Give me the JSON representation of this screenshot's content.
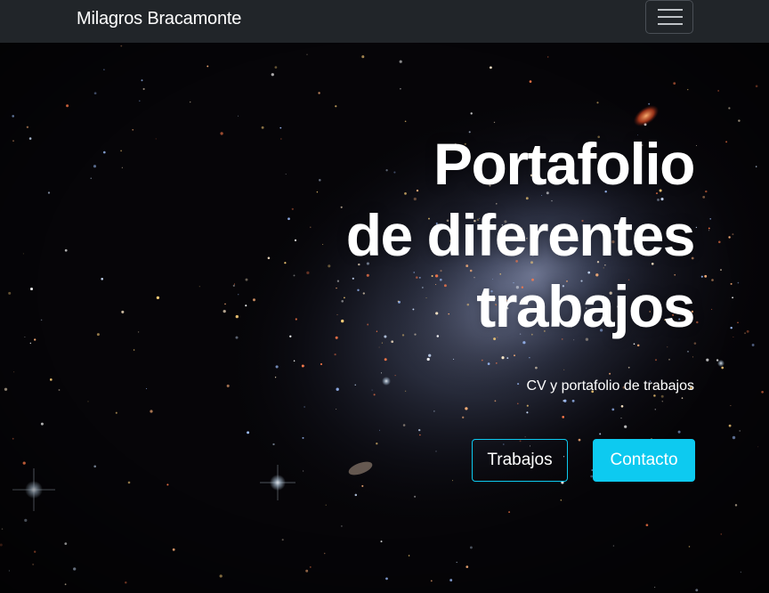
{
  "navbar": {
    "brand": "Milagros Bracamonte",
    "toggler_icon": "hamburger-icon"
  },
  "hero": {
    "title_lines": [
      "Portafolio",
      "de diferentes",
      "trabajos"
    ],
    "subtitle": "CV y portafolio de trabajos",
    "buttons": {
      "primary_outline": "Trabajos",
      "primary_solid": "Contacto"
    },
    "background_image": "galaxy-starfield"
  },
  "colors": {
    "navbar_bg": "#212529",
    "accent": "#0dcaf0",
    "text": "#ffffff",
    "hero_bg": "#050407"
  }
}
